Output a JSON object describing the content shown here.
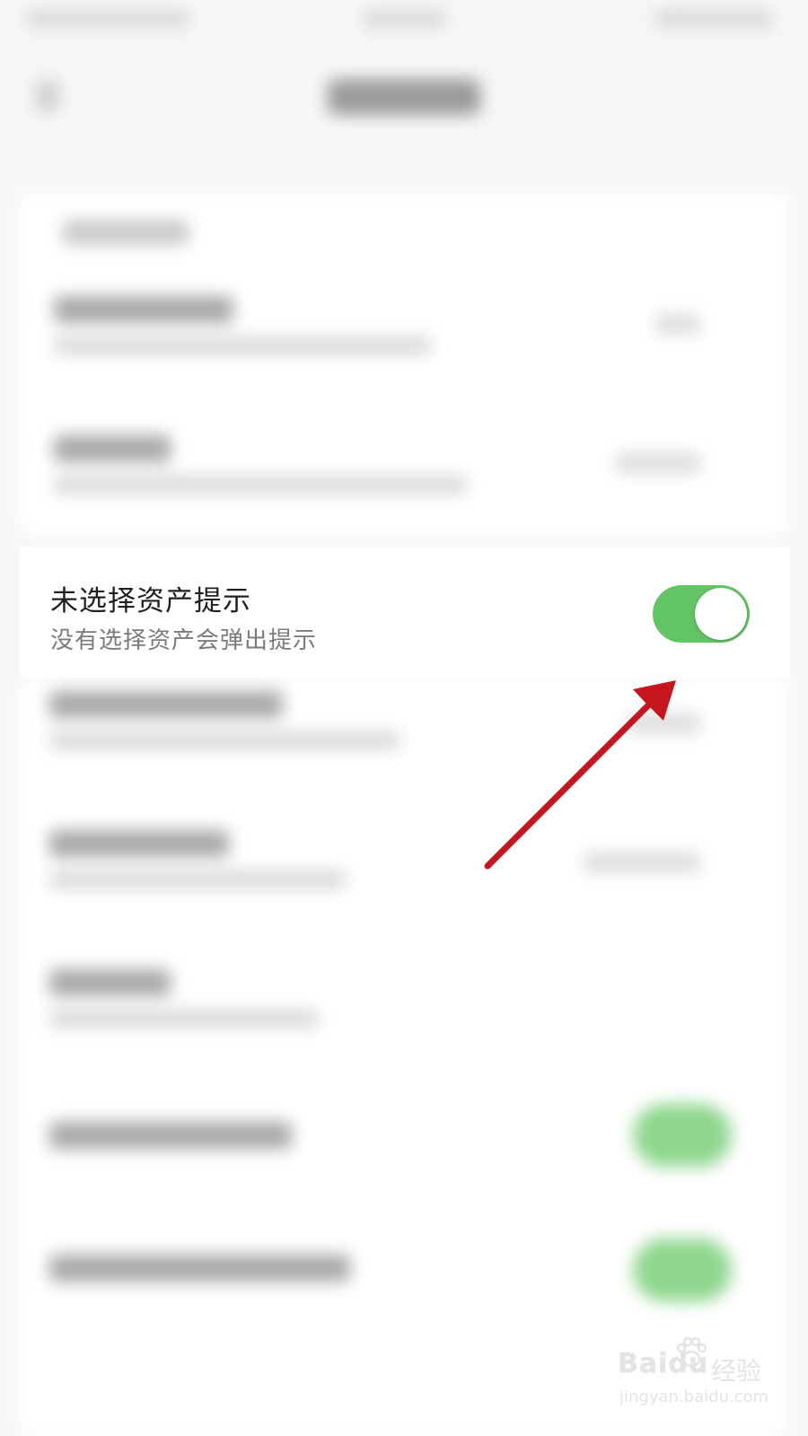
{
  "setting_row": {
    "title": "未选择资产提示",
    "subtitle": "没有选择资产会弹出提示",
    "toggle_on": true
  },
  "colors": {
    "toggle_on": "#63c465",
    "annotation_arrow": "#c4161c",
    "background": "#f7f7f7",
    "card": "#ffffff"
  },
  "icons": {
    "annotation": "arrow-icon",
    "watermark_paw": "paw-icon"
  },
  "watermark": {
    "logo": "Baidu",
    "brand_cn": "经验",
    "url": "jingyan.baidu.com"
  }
}
